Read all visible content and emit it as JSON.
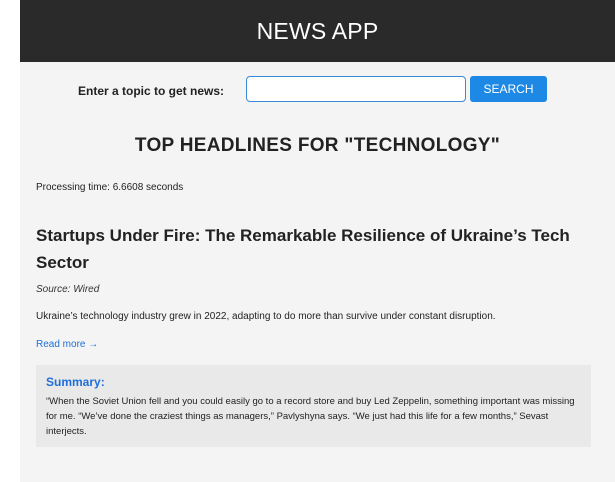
{
  "header": {
    "title": "NEWS APP"
  },
  "search": {
    "label": "Enter a topic to get news:",
    "value": "",
    "placeholder": "",
    "button_label": "SEARCH"
  },
  "results": {
    "heading": "TOP HEADLINES FOR \"TECHNOLOGY\"",
    "processing_time": "Processing time: 6.6608 seconds"
  },
  "article": {
    "title": "Startups Under Fire: The Remarkable Resilience of Ukraine’s Tech Sector",
    "source": "Source: Wired",
    "description": "Ukraine’s technology industry grew in 2022, adapting to do more than survive under constant disruption.",
    "read_more": "Read more →",
    "summary_heading": "Summary:",
    "summary_text": "“When the Soviet Union fell and you could easily go to a record store and buy Led Zeppelin, something important was missing for me. “We’ve done the craziest things as managers,” Pavlyshyna says. “We just had this life for a few months,” Sevast interjects."
  },
  "colors": {
    "header_bg": "#2a2a2a",
    "accent": "#1e88e5",
    "link": "#1e6fd9",
    "content_bg": "#f4f4f4",
    "summary_bg": "#e9e9e9"
  }
}
